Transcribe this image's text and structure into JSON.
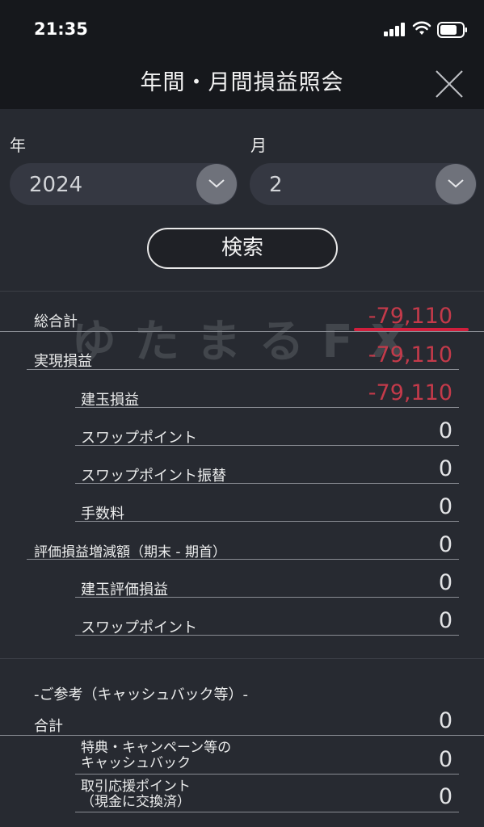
{
  "status": {
    "time": "21:35"
  },
  "header": {
    "title": "年間・月間損益照会"
  },
  "filters": {
    "year_label": "年",
    "year_value": "2024",
    "month_label": "月",
    "month_value": "2"
  },
  "search_label": "検索",
  "watermark": "ゆたまるFX",
  "rows": {
    "total": {
      "label": "総合計",
      "value": "-79,110"
    },
    "realized": {
      "label": "実現損益",
      "value": "-79,110"
    },
    "position_pl": {
      "label": "建玉損益",
      "value": "-79,110"
    },
    "swap": {
      "label": "スワップポイント",
      "value": "0"
    },
    "swap_transfer": {
      "label": "スワップポイント振替",
      "value": "0"
    },
    "fee": {
      "label": "手数料",
      "value": "0"
    },
    "eval_change": {
      "label": "評価損益増減額（期末 - 期首）",
      "value": "0"
    },
    "position_eval": {
      "label": "建玉評価損益",
      "value": "0"
    },
    "eval_swap": {
      "label": "スワップポイント",
      "value": "0"
    }
  },
  "reference": {
    "heading": "-ご参考（キャッシュバック等）-",
    "total": {
      "label": "合計",
      "value": "0"
    },
    "cashback": {
      "label_line1": "特典・キャンペーン等の",
      "label_line2": "キャッシュバック",
      "value": "0"
    },
    "support_points": {
      "label_line1": "取引応援ポイント",
      "label_line2": "（現金に交換済）",
      "value": "0"
    }
  },
  "colors": {
    "negative": "#c43a4a",
    "highlight": "#d11e3c",
    "background": "#272a31"
  }
}
